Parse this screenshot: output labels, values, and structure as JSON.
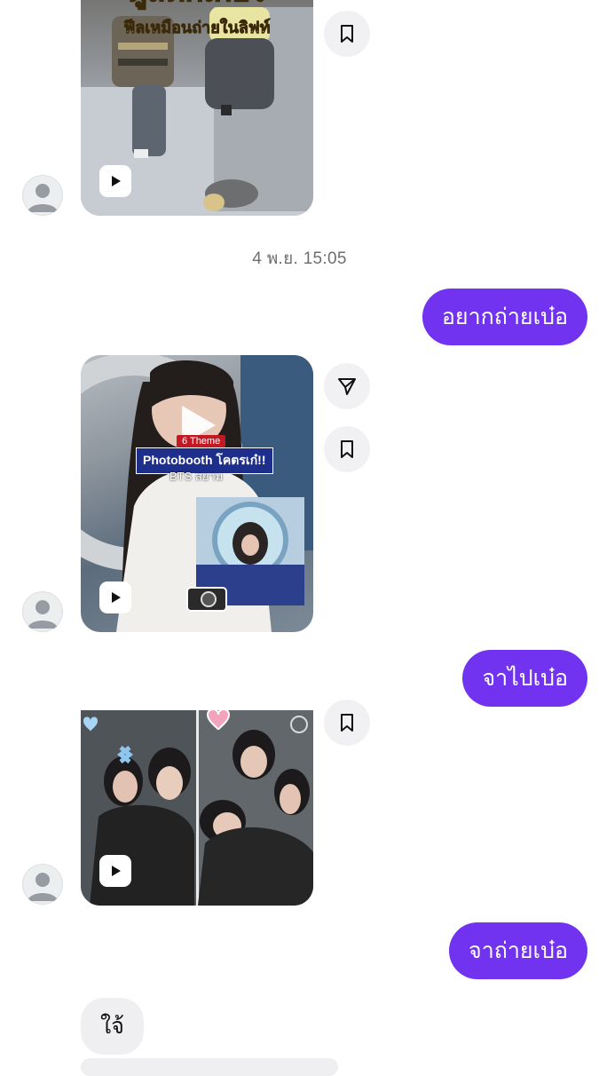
{
  "timestamp": "4 พ.ย. 15:05",
  "messages_out": [
    {
      "text": "อยากถ่ายเบ๋อ"
    },
    {
      "text": "จาไปเบ๋อ"
    },
    {
      "text": "จาถ่ายเบ๋อ"
    }
  ],
  "message_in": {
    "text": "ใจ้"
  },
  "media_cards": [
    {
      "overlay_title": "ตู้สติ๊กเกอร์",
      "overlay_subtitle": "ฟีลเหมือนถ่ายในลิฟท์"
    },
    {
      "overlay_badge": "6 Theme",
      "overlay_title": "Photobooth โคตรเก๋!!",
      "overlay_location": "BTS สยาม"
    },
    {}
  ],
  "icons": {
    "avatar": "default-avatar-icon",
    "play": "reel-play-icon",
    "save": "bookmark-icon",
    "share": "send-icon",
    "big_play": "video-play-icon"
  },
  "colors": {
    "accent": "#7133f0",
    "incoming_bubble": "#efeff1",
    "action_bg": "#f1f1f3"
  }
}
